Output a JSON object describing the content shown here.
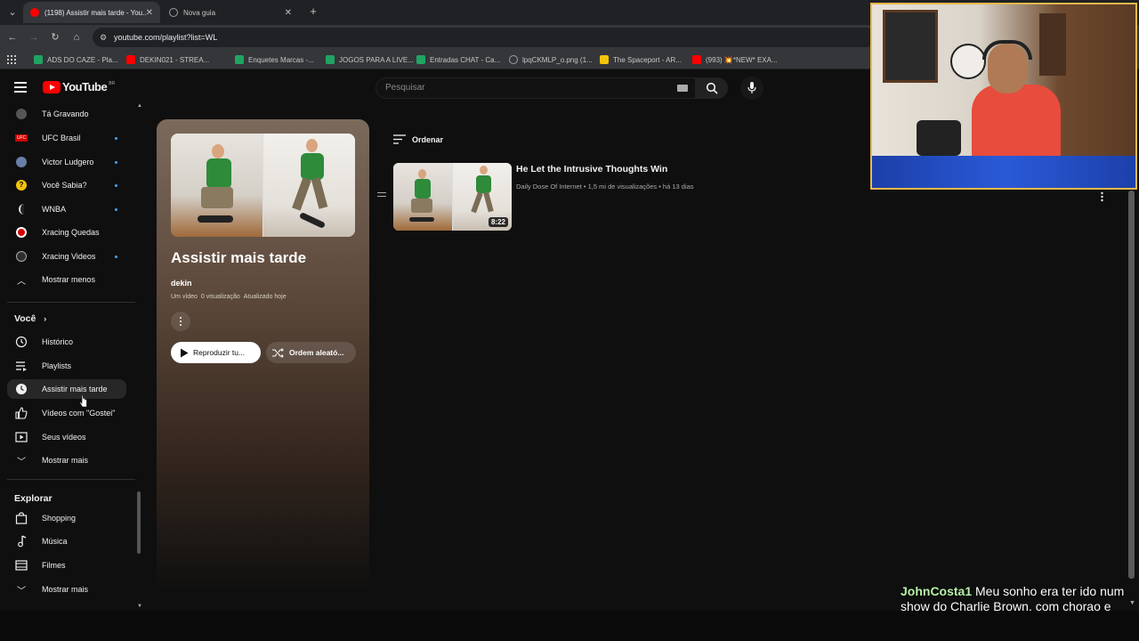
{
  "browser": {
    "tabs": [
      {
        "title": "(1198) Assistir mais tarde - You...",
        "active": true
      },
      {
        "title": "Nova guia",
        "active": false
      }
    ],
    "url": "youtube.com/playlist?list=WL",
    "bookmarks": [
      {
        "label": "ADS DO CAZE - Pla...",
        "color": "#1fa463"
      },
      {
        "label": "DEKIN021 - STREA...",
        "color": "#ff0000"
      },
      {
        "label": "Enquetes Marcas -...",
        "color": "#1fa463"
      },
      {
        "label": "JOGOS PARA A LIVE...",
        "color": "#1fa463"
      },
      {
        "label": "Entradas CHAT - Ca...",
        "color": "#1fa463"
      },
      {
        "label": "lpqCKMLP_o.png (1...",
        "color": "#9aa0a6"
      },
      {
        "label": "The Spaceport - AR...",
        "color": "#f4c20d"
      },
      {
        "label": "(993) 💥*NEW* EXA...",
        "color": "#ff0000"
      }
    ]
  },
  "youtube": {
    "logo_text": "YouTube",
    "country": "BR",
    "search_placeholder": "Pesquisar"
  },
  "sidebar": {
    "subscriptions": [
      {
        "label": "Tá Gravando",
        "dot": false,
        "color": "#555"
      },
      {
        "label": "UFC Brasil",
        "dot": true,
        "color": "#c00"
      },
      {
        "label": "Victor Ludgero",
        "dot": true,
        "color": "#6a7fa8"
      },
      {
        "label": "Você Sabia?",
        "dot": true,
        "color": "#f4c20d"
      },
      {
        "label": "WNBA",
        "dot": true,
        "color": "#222"
      },
      {
        "label": "Xracing Quedas",
        "dot": false,
        "color": "#d40000"
      },
      {
        "label": "Xracing Videos",
        "dot": true,
        "color": "#2e2e2e"
      }
    ],
    "show_less": "Mostrar menos",
    "you_header": "Você",
    "you_items": [
      {
        "label": "Histórico",
        "icon": "history-icon"
      },
      {
        "label": "Playlists",
        "icon": "playlists-icon"
      },
      {
        "label": "Assistir mais tarde",
        "icon": "watch-later-icon",
        "active": true
      },
      {
        "label": "Vídeos com \"Gostei\"",
        "icon": "like-icon"
      },
      {
        "label": "Seus vídeos",
        "icon": "your-videos-icon"
      }
    ],
    "show_more_1": "Mostrar mais",
    "explore_header": "Explorar",
    "explore_items": [
      {
        "label": "Shopping",
        "icon": "shopping-icon"
      },
      {
        "label": "Música",
        "icon": "music-icon"
      },
      {
        "label": "Filmes",
        "icon": "movies-icon"
      }
    ],
    "show_more_2": "Mostrar mais"
  },
  "playlist": {
    "title": "Assistir mais tarde",
    "owner": "dekin",
    "meta_videos": "Um vídeo",
    "meta_views": "0 visualização",
    "meta_updated": "Atualizado hoje",
    "play_label": "Reproduzir tu...",
    "shuffle_label": "Ordem aleató..."
  },
  "sort_label": "Ordenar",
  "videos": [
    {
      "title": "He Let the Intrusive Thoughts Win",
      "channel": "Daily Dose Of Internet",
      "views": "1,5 mi de visualizações",
      "age": "há 13 dias",
      "duration": "8:22"
    }
  ],
  "chat": {
    "user": "JohnCosta1",
    "message": "Meu sonho era ter ido num show do Charlie Brown, com chorao e companhia"
  }
}
